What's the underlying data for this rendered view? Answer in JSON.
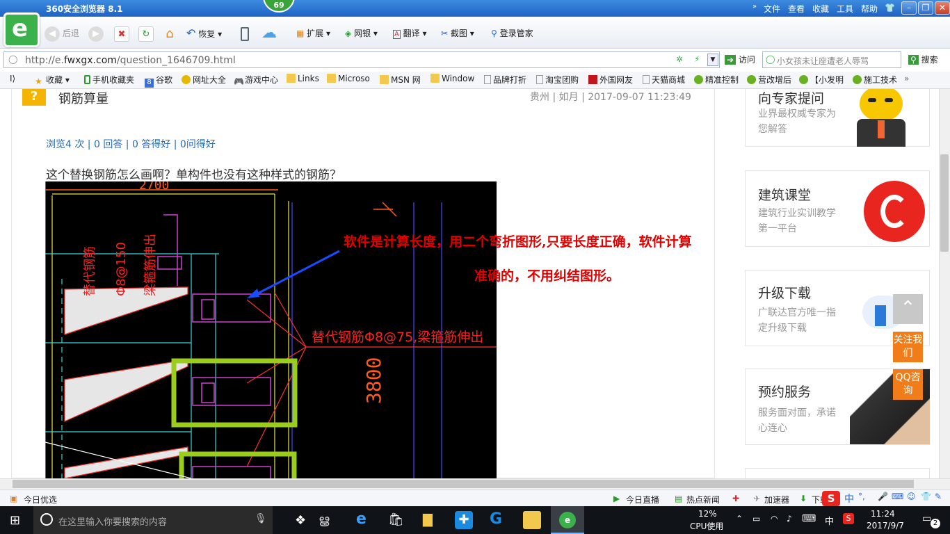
{
  "browser": {
    "title": "360安全浏览器 8.1",
    "badge": "69",
    "menu": [
      "文件",
      "查看",
      "收藏",
      "工具",
      "帮助"
    ],
    "clock_small": "11:24"
  },
  "toolbar": {
    "back": "后退",
    "restore": "恢复",
    "extend": "扩展",
    "netbank": "网银",
    "translate": "翻译",
    "screenshot": "截图",
    "login": "登录管家"
  },
  "address": {
    "url_prefix": "http://e.",
    "url_domain": "fwxgx.com",
    "url_path": "/question_1646709.html",
    "visit": "访问",
    "search_text": "小女孩未让座遭老人辱骂",
    "search_button": "搜索"
  },
  "favorites": [
    "收藏",
    "手机收藏夹",
    "谷歌",
    "网址大全",
    "游戏中心",
    "Links",
    "Microso",
    "MSN 网",
    "Window",
    "品牌打折",
    "淘宝团购",
    "外国网友",
    "天猫商城",
    "精准控制",
    "营改增后",
    "【小发明",
    "施工技术"
  ],
  "question": {
    "title": "钢筋算量",
    "meta": "贵州 | 如月 | 2017-09-07 11:23:49",
    "stats": "浏览4 次 | 0 回答 | 0 答得好 | 0问得好",
    "body": "这个替换钢筋怎么画啊？单构件也没有这种样式的钢筋？"
  },
  "drawing": {
    "dim_top": "2700",
    "dim_side": "3800",
    "label_vertical_1": "替代钢筋",
    "label_vertical_2": "Φ8@150",
    "label_vertical_3": "梁箍筋伸出",
    "label_horizontal": "替代钢筋Φ8@75,梁箍筋伸出"
  },
  "answer_overlay": {
    "line1": "软件是计算长度，用二个弯折图形,只要长度正确，软件计算",
    "line2": "准确的，不用纠结图形。"
  },
  "sidebar": {
    "cards": [
      {
        "title": "向专家提问",
        "sub": "业界最权威专家为您解答"
      },
      {
        "title": "建筑课堂",
        "sub": "建筑行业实训教学第一平台"
      },
      {
        "title": "升级下载",
        "sub": "广联达官方唯一指定升级下载"
      },
      {
        "title": "预约服务",
        "sub": "服务面对面，承诺心连心"
      }
    ],
    "follow": "关注我们",
    "qq": "QQ咨询"
  },
  "statusbar": {
    "left": "今日优选",
    "live": "今日直播",
    "news": "热点新闻",
    "accel": "加速器",
    "download": "下载"
  },
  "taskbar": {
    "search_placeholder": "在这里输入你要搜索的内容",
    "cpu_pct": "12%",
    "cpu_label": "CPU使用",
    "time": "11:24",
    "date": "2017/9/7",
    "ime": "中",
    "notifications": "2"
  },
  "colors": {
    "title_blue": "#1f63c4",
    "logo_green": "#3ab14a",
    "cad_bg": "#000000",
    "answer_red": "#e00000",
    "side_orange": "#f07d1a"
  }
}
